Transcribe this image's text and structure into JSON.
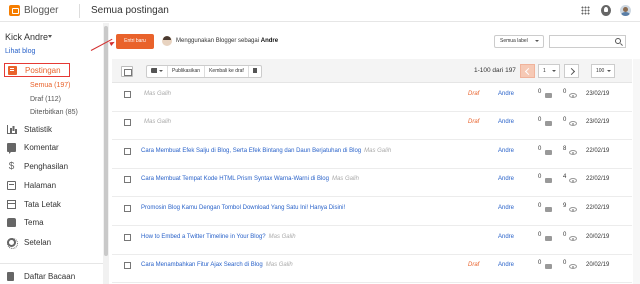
{
  "app": {
    "name": "Blogger",
    "page_title": "Semua postingan"
  },
  "sidebar": {
    "blog_name": "Kick Andre",
    "view_blog": "Lihat blog",
    "nav": [
      {
        "label": "Postingan",
        "icon": "posts-icon",
        "active": true
      },
      {
        "label": "Statistik",
        "icon": "stats-icon"
      },
      {
        "label": "Komentar",
        "icon": "comment-icon"
      },
      {
        "label": "Penghasilan",
        "icon": "dollar-icon"
      },
      {
        "label": "Halaman",
        "icon": "page-icon"
      },
      {
        "label": "Tata Letak",
        "icon": "layout-icon"
      },
      {
        "label": "Tema",
        "icon": "theme-icon"
      },
      {
        "label": "Setelan",
        "icon": "gear-icon"
      },
      {
        "label": "Daftar Bacaan",
        "icon": "reading-list-icon"
      }
    ],
    "sub": [
      {
        "label": "Semua (197)",
        "active": true
      },
      {
        "label": "Draf (112)"
      },
      {
        "label": "Diterbitkan (85)"
      }
    ]
  },
  "actions": {
    "new_post": "Entri baru",
    "using_prefix": "Menggunakan Blogger sebagai",
    "using_user": "Andre",
    "label_filter": "Semua label",
    "search_placeholder": ""
  },
  "toolbar": {
    "publish": "Publikasikan",
    "revert": "Kembali ke draf",
    "range": "1-100 dari 197",
    "page": "1",
    "per_page": "100"
  },
  "posts": [
    {
      "title": "",
      "author_inline": "Mas Galih",
      "status": "Draf",
      "author": "Andre",
      "comments": "0",
      "views": "0",
      "date": "23/02/19"
    },
    {
      "title": "",
      "author_inline": "Mas Galih",
      "status": "Draf",
      "author": "Andre",
      "comments": "0",
      "views": "0",
      "date": "23/02/19"
    },
    {
      "title": "Cara Membuat Efek Salju di Blog, Serta Efek Bintang dan Daun Berjatuhan di Blog",
      "author_inline": "Mas Galih",
      "status": "",
      "author": "Andre",
      "comments": "0",
      "views": "8",
      "date": "22/02/19"
    },
    {
      "title": "Cara Membuat Tempat Kode HTML Prism Syntax Warna-Warni di Blog",
      "author_inline": "Mas Galih",
      "status": "",
      "author": "Andre",
      "comments": "0",
      "views": "4",
      "date": "22/02/19"
    },
    {
      "title": "Promosin Blog Kamu Dengan Tombol Download Yang Satu Ini! Hanya Disini!",
      "author_inline": "",
      "status": "",
      "author": "Andre",
      "comments": "0",
      "views": "9",
      "date": "22/02/19"
    },
    {
      "title": "How to Embed a Twitter Timeline in Your Blog?",
      "author_inline": "Mas Galih",
      "status": "",
      "author": "Andre",
      "comments": "0",
      "views": "0",
      "date": "20/02/19"
    },
    {
      "title": "Cara Menambahkan Fitur Ajax Search di Blog",
      "author_inline": "Mas Galih",
      "status": "Draf",
      "author": "Andre",
      "comments": "0",
      "views": "0",
      "date": "20/02/19"
    }
  ],
  "colors": {
    "accent": "#e9622b",
    "link": "#2962c9",
    "highlight": "#e53935"
  }
}
